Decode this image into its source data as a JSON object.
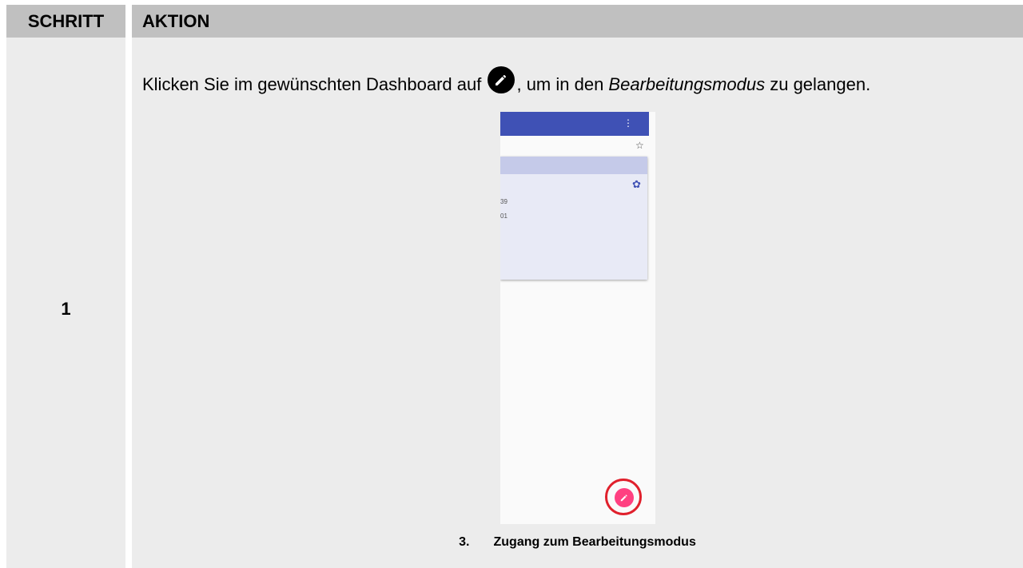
{
  "table": {
    "header_step": "SCHRITT",
    "header_action": "AKTION"
  },
  "row": {
    "step_number": "1",
    "instruction_before": "Klicken Sie im gewünschten Dashboard auf ",
    "instruction_icon": "pencil-icon",
    "instruction_middle": ", um in den ",
    "instruction_emphasis": "Bearbeitungsmodus",
    "instruction_after": " zu gelangen."
  },
  "screenshot": {
    "menu_dots": "⋮",
    "star_icon": "☆",
    "gear_icon": "✿",
    "value_1": "39",
    "value_2": "01",
    "appbar_color": "#3f51b5",
    "fab_color": "#ff4081",
    "highlight_color": "#e0202c"
  },
  "caption": {
    "number": "3.",
    "text": "Zugang zum Bearbeitungsmodus"
  }
}
